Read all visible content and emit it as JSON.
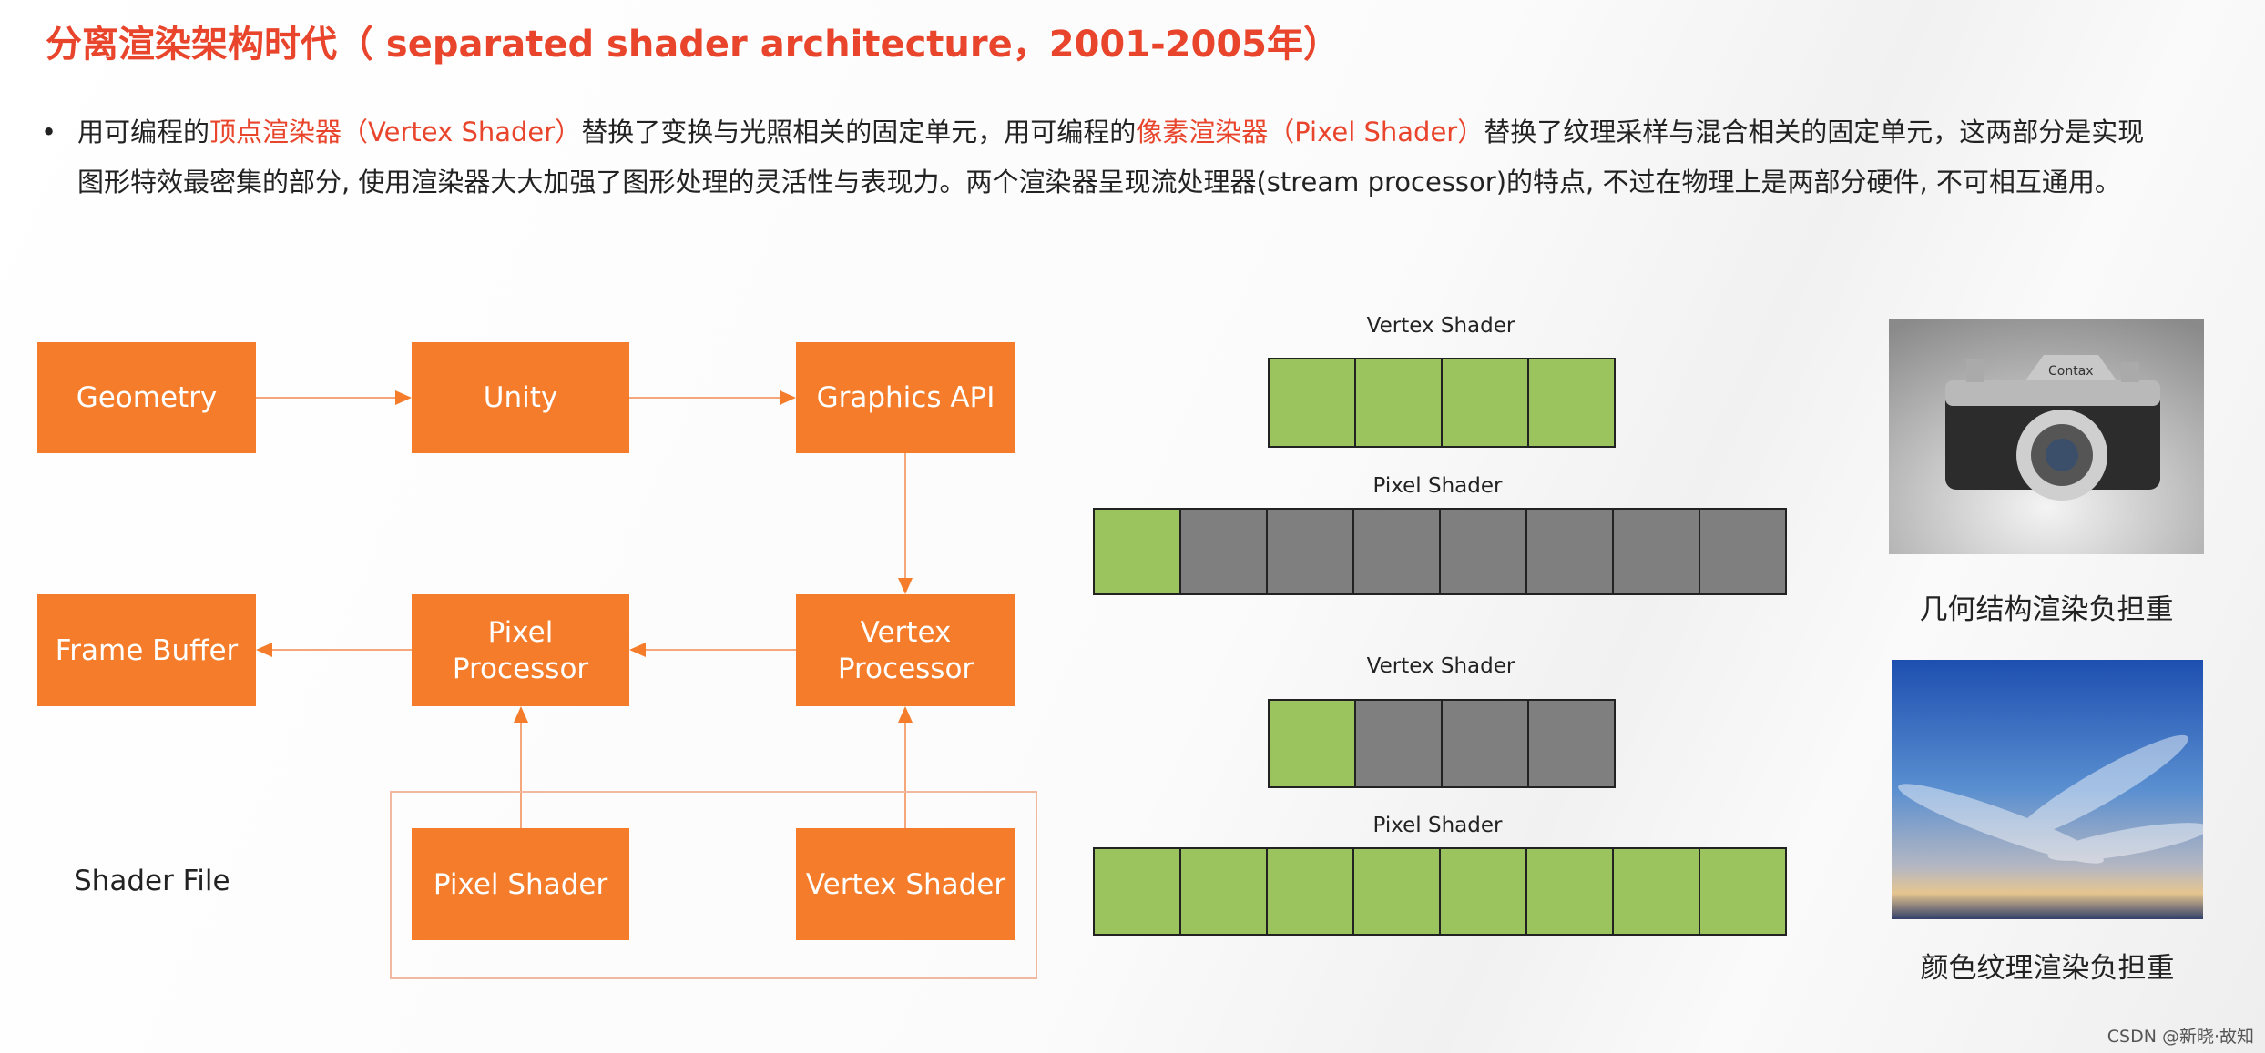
{
  "title": "分离渲染架构时代（ separated shader architecture，2001-2005年）",
  "bullet": {
    "part1": "用可编程的",
    "hl1": "顶点渲染器（Vertex Shader）",
    "part2": "替换了变换与光照相关的固定单元，用可编程的",
    "hl2": "像素渲染器（Pixel Shader）",
    "part3": "替换了纹理采样与混合相关的固定单元，这两部分是实现图形特效最密集的部分, 使用渲染器大大加强了图形处理的灵活性与表现力。两个渲染器呈现流处理器(stream processor)的特点, 不过在物理上是两部分硬件, 不可相互通用。"
  },
  "diagram": {
    "geometry": "Geometry",
    "unity": "Unity",
    "graphics_api": "Graphics API",
    "frame_buffer": "Frame Buffer",
    "pixel_processor": "Pixel Processor",
    "vertex_processor": "Vertex Processor",
    "shader_file": "Shader File",
    "pixel_shader": "Pixel Shader",
    "vertex_shader": "Vertex Shader",
    "box_color": "#f47c2a"
  },
  "load_rows": [
    {
      "label": "Vertex Shader",
      "cells": [
        "busy",
        "busy",
        "busy",
        "busy"
      ]
    },
    {
      "label": "Pixel Shader",
      "cells": [
        "busy",
        "idle",
        "idle",
        "idle",
        "idle",
        "idle",
        "idle",
        "idle"
      ]
    },
    {
      "label": "Vertex Shader",
      "cells": [
        "busy",
        "idle",
        "idle",
        "idle"
      ]
    },
    {
      "label": "Pixel Shader",
      "cells": [
        "busy",
        "busy",
        "busy",
        "busy",
        "busy",
        "busy",
        "busy",
        "busy"
      ]
    }
  ],
  "colors": {
    "busy": "#9bc45f",
    "idle": "#7f7f7f",
    "accent": "#e8452c"
  },
  "images": {
    "camera_caption": "几何结构渲染负担重",
    "camera_brand": "Contax",
    "sky_caption": "颜色纹理渲染负担重"
  },
  "watermark": "CSDN @新晓·故知"
}
